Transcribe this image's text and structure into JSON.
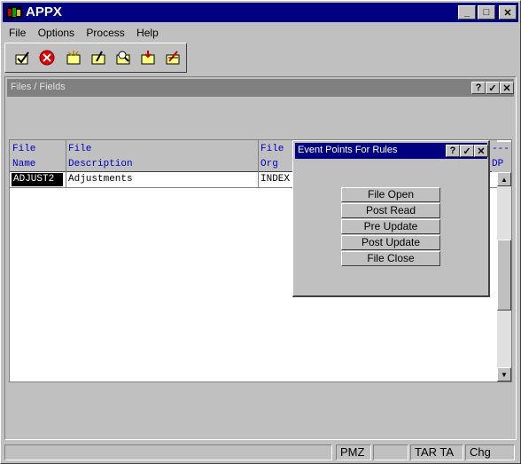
{
  "app": {
    "title": "APPX"
  },
  "title_buttons": {
    "minimize": "_",
    "maximize": "□",
    "close": "✕"
  },
  "menu": [
    {
      "label": "File"
    },
    {
      "label": "Options"
    },
    {
      "label": "Process"
    },
    {
      "label": "Help"
    }
  ],
  "toolbar": [
    {
      "icon": "check-icon"
    },
    {
      "icon": "cancel-icon"
    },
    {
      "icon": "add-record-icon"
    },
    {
      "icon": "change-record-icon"
    },
    {
      "icon": "inquire-record-icon"
    },
    {
      "icon": "delete-record-icon"
    },
    {
      "icon": "edit-record-icon"
    }
  ],
  "files_window": {
    "title": "Files / Fields",
    "buttons": {
      "help": "?",
      "ok": "✓",
      "close": "✕"
    },
    "columns": [
      {
        "line1": "File",
        "line2": "Name"
      },
      {
        "line1": "File",
        "line2": "Description"
      },
      {
        "line1": "File",
        "line2": "Org"
      },
      {
        "line1": "---",
        "line2": "DP"
      }
    ],
    "rows": [
      {
        "name": "ADJUST2",
        "description": "Adjustments",
        "org": "INDEX"
      }
    ]
  },
  "event_dialog": {
    "title": "Event Points For Rules",
    "buttons": {
      "help": "?",
      "ok": "✓",
      "close": "✕"
    },
    "actions": [
      {
        "label": "File Open"
      },
      {
        "label": "Post Read"
      },
      {
        "label": "Pre Update"
      },
      {
        "label": "Post Update"
      },
      {
        "label": "File Close"
      }
    ]
  },
  "status_bar": [
    {
      "text": ""
    },
    {
      "text": "PMZ"
    },
    {
      "text": ""
    },
    {
      "text": "TAR TA"
    },
    {
      "text": "Chg"
    }
  ],
  "colors": {
    "titlebar": "#000080",
    "header_text": "#0000c0",
    "selected_cell": "#000000"
  }
}
